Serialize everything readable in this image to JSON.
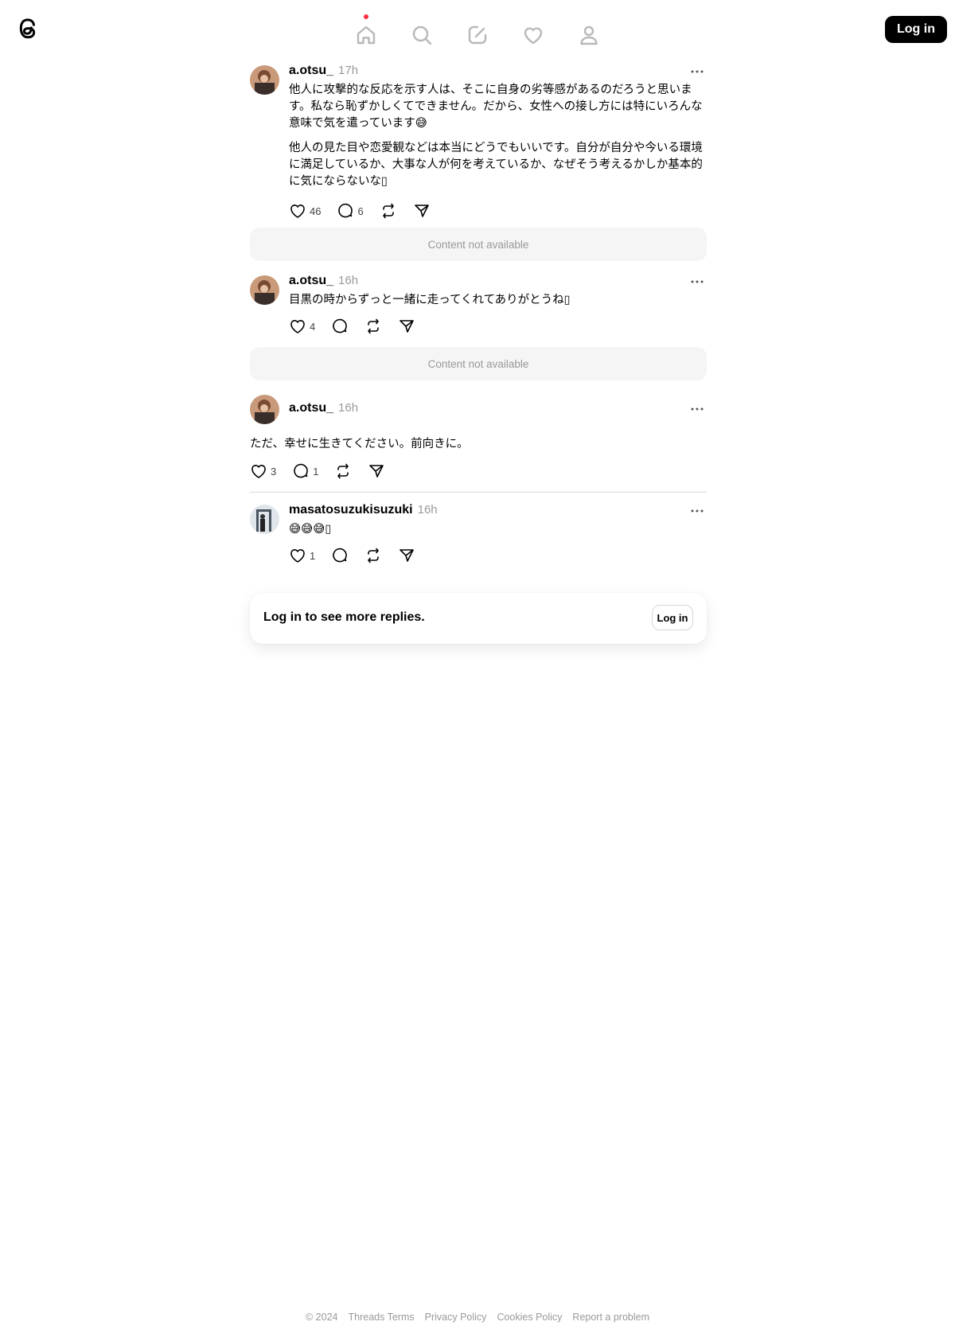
{
  "header": {
    "nav": [
      "home",
      "search",
      "create",
      "activity",
      "profile"
    ],
    "login_label": "Log in"
  },
  "posts": [
    {
      "username": "a.otsu_",
      "time": "17h",
      "paragraphs": [
        "他人に攻撃的な反応を示す人は、そこに自身の劣等感があるのだろうと思います。私なら恥ずかしくてできません。だから、女性への接し方には特にいろんな意味で気を遣っています😅",
        "他人の見た目や恋愛観などは本当にどうでもいいです。自分が自分や今いる環境に満足しているか、大事な人が何を考えているか、なぜそう考えるかしか基本的に気にならないな▯"
      ],
      "likes": "46",
      "replies": "6"
    },
    {
      "content_not_available": "Content not available"
    },
    {
      "username": "a.otsu_",
      "time": "16h",
      "paragraphs": [
        "目黒の時からずっと一緒に走ってくれてありがとうね▯"
      ],
      "likes": "4",
      "replies": ""
    },
    {
      "content_not_available": "Content not available"
    },
    {
      "username": "a.otsu_",
      "time": "16h",
      "paragraphs": [
        "ただ、幸せに生きてください。前向きに。"
      ],
      "likes": "3",
      "replies": "1"
    },
    {
      "username": "masatosuzukisuzuki",
      "time": "16h",
      "paragraphs": [
        "😅😅😅▯"
      ],
      "likes": "1",
      "replies": ""
    }
  ],
  "login_prompt": {
    "message": "Log in to see more replies.",
    "button": "Log in"
  },
  "footer": {
    "copyright": "© 2024",
    "links": [
      "Threads Terms",
      "Privacy Policy",
      "Cookies Policy",
      "Report a problem"
    ]
  },
  "colors": {
    "accent_dot": "#ff3040",
    "muted_text": "#999999",
    "not_available_bg": "#f5f5f5"
  }
}
